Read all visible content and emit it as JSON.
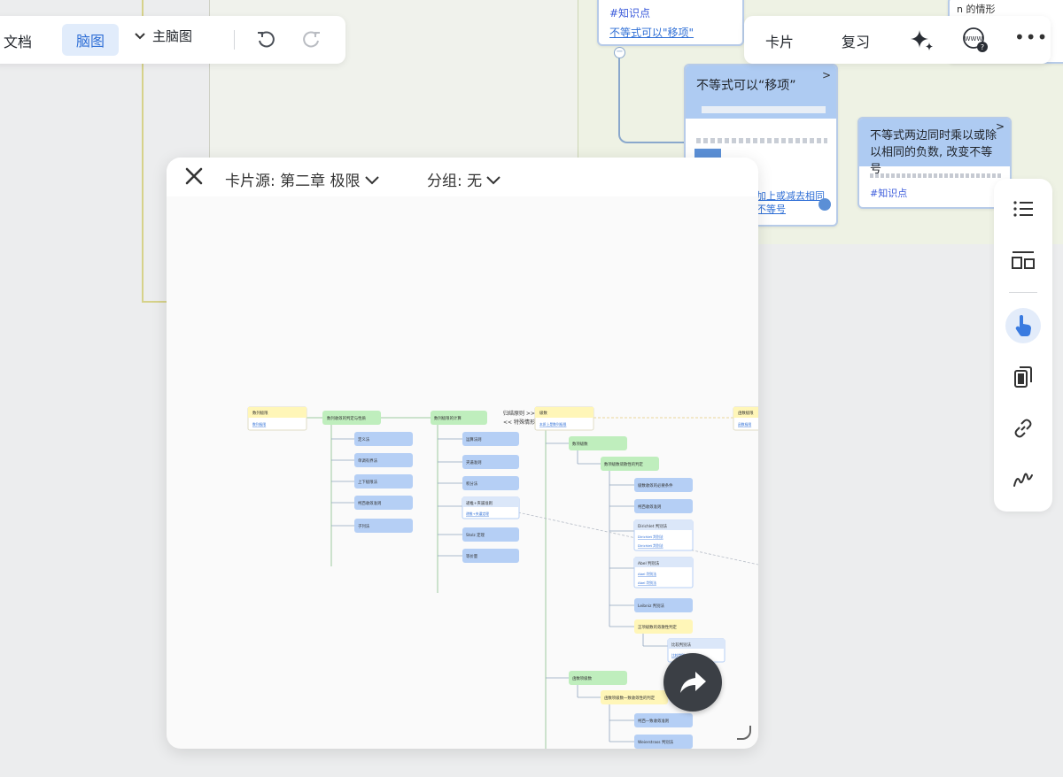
{
  "toolbar_left": {
    "doc_tab": "文档",
    "mindmap_tab": "脑图",
    "main_map_label": "主脑图",
    "undo_icon": "undo-icon",
    "redo_icon": "redo-icon"
  },
  "toolbar_right": {
    "card": "卡片",
    "review": "复习",
    "ai_icon": "sparkle-icon",
    "web_icon": "www-help-icon",
    "more": "•••"
  },
  "background": {
    "card_top": {
      "tag": "#知识点",
      "link": "不等式可以\"移项\""
    },
    "card_move": {
      "title": "不等式可以“移项”",
      "tail": "加上或减去相同\n不等号"
    },
    "card_mul": {
      "title": "不等式两边同时乘以或除以相同的负数, 改变不等号",
      "tag": "#知识点"
    },
    "card_n": {
      "text": "n 的情形"
    }
  },
  "side_panel": {
    "items": [
      "outline-list-icon",
      "layout-icon",
      "pointer-hand-icon",
      "copy-icon",
      "link-icon",
      "draw-stroke-icon"
    ]
  },
  "modal": {
    "card_source": "卡片源: 第二章 极限",
    "group": "分组: 无",
    "close_icon": "close-icon",
    "share_icon": "share-arrow-icon",
    "mindmap": {
      "left_node": "数列极限",
      "left_node_link": "数列极限",
      "node_a": "数列收敛的判定与性质",
      "node_a_children": [
        "定义法",
        "单调有界法",
        "上下极限法",
        "柯西收敛准则",
        "子列法"
      ],
      "node_b": "数列极限的计算",
      "node_b_children": [
        "运算法则",
        "夹逼准则",
        "积分法",
        "递推+夹逼准则",
        "Stolz 定理",
        "等价量"
      ],
      "node_b_child_link": "递推+夹逼定理",
      "arrow_label_right": "归结原则 >>",
      "arrow_label_left": "<< 特殊情形",
      "node_c": "级数",
      "node_c_sub": "本质上是数列极限",
      "right_node": "函数极限",
      "right_node_link": "函数极限",
      "series_node": "数项级数",
      "series_judge": "数项级数敛散性的判定",
      "series_children": [
        "级数收敛的必要条件",
        "柯西收敛准则",
        "Dirichlet 判别法",
        "Abel 判别法",
        "Leibniz 判别法",
        "正项级数的敛散性判定"
      ],
      "dirichlet_links": [
        "Dirichlet 判别法",
        "Dirichlet 判别法"
      ],
      "abel_links": [
        "Abel 判别法",
        "Abel 判别法"
      ],
      "compare_node": "比较判别法",
      "compare_link": "比较判别",
      "func_series": "函数项级数",
      "func_judge": "函数项级数一致收敛性的判定",
      "func_children": [
        "柯西一致收敛准则",
        "Weierstrass 判别法"
      ]
    }
  }
}
